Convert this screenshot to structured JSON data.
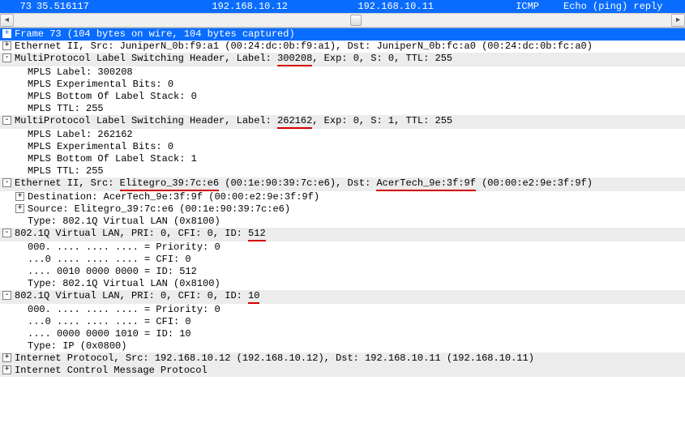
{
  "packet_row": {
    "no": "73",
    "time": "35.516117",
    "source": "192.168.10.12",
    "destination": "192.168.10.11",
    "protocol": "ICMP",
    "info": "Echo (ping) reply"
  },
  "frame": {
    "summary": "Frame 73 (104 bytes on wire, 104 bytes captured)"
  },
  "eth_outer": {
    "summary": "Ethernet II, Src: JuniperN_0b:f9:a1 (00:24:dc:0b:f9:a1), Dst: JuniperN_0b:fc:a0 (00:24:dc:0b:fc:a0)"
  },
  "mpls1": {
    "summary_pre": "MultiProtocol Label Switching Header, Label: ",
    "label_hl": "300208",
    "summary_post": ", Exp: 0, S: 0, TTL: 255",
    "child_label": "MPLS Label: 300208",
    "child_exp": "MPLS Experimental Bits: 0",
    "child_bos": "MPLS Bottom Of Label Stack: 0",
    "child_ttl": "MPLS TTL: 255"
  },
  "mpls2": {
    "summary_pre": "MultiProtocol Label Switching Header, Label: ",
    "label_hl": "262162",
    "summary_post": ", Exp: 0, S: 1, TTL: 255",
    "child_label": "MPLS Label: 262162",
    "child_exp": "MPLS Experimental Bits: 0",
    "child_bos": "MPLS Bottom Of Label Stack: 1",
    "child_ttl": "MPLS TTL: 255"
  },
  "eth_inner": {
    "pre": "Ethernet II, Src: ",
    "src_hl": "Elitegro_39:7c:e6",
    "mid": " (00:1e:90:39:7c:e6), Dst: ",
    "dst_hl": "AcerTech_9e:3f:9f",
    "post": " (00:00:e2:9e:3f:9f)",
    "child_dst": "Destination: AcerTech_9e:3f:9f (00:00:e2:9e:3f:9f)",
    "child_src": "Source: Elitegro_39:7c:e6 (00:1e:90:39:7c:e6)",
    "child_type": "Type: 802.1Q Virtual LAN (0x8100)"
  },
  "vlan1": {
    "pre": "802.1Q Virtual LAN, PRI: 0, CFI: 0, ID: ",
    "id_hl": "512",
    "child_pri": "000. .... .... .... = Priority: 0",
    "child_cfi": "...0 .... .... .... = CFI: 0",
    "child_id": ".... 0010 0000 0000 = ID: 512",
    "child_type": "Type: 802.1Q Virtual LAN (0x8100)"
  },
  "vlan2": {
    "pre": "802.1Q Virtual LAN, PRI: 0, CFI: 0, ID: ",
    "id_hl": "10",
    "child_pri": "000. .... .... .... = Priority: 0",
    "child_cfi": "...0 .... .... .... = CFI: 0",
    "child_id": ".... 0000 0000 1010 = ID: 10",
    "child_type": "Type: IP (0x0800)"
  },
  "ip": {
    "summary": "Internet Protocol, Src: 192.168.10.12 (192.168.10.12), Dst: 192.168.10.11 (192.168.10.11)"
  },
  "icmp": {
    "summary": "Internet Control Message Protocol"
  },
  "glyph": {
    "plus": "+",
    "minus": "-",
    "left": "◄",
    "right": "►"
  }
}
